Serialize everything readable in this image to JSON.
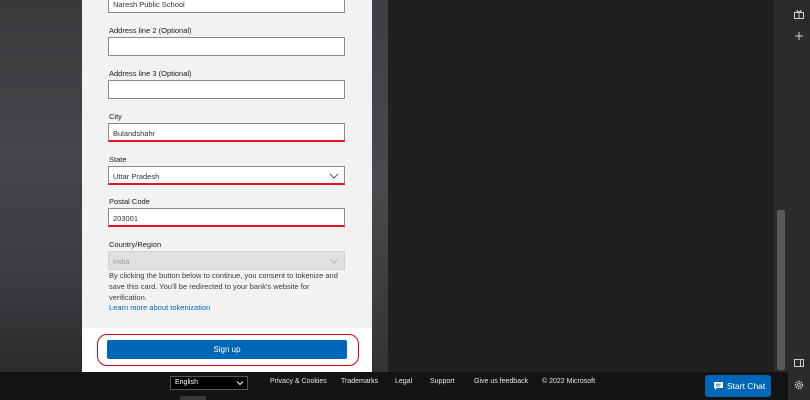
{
  "form": {
    "address_line1_value": "Naresh Public School",
    "address_line2_label": "Address line 2 (Optional)",
    "address_line2_value": "",
    "address_line3_label": "Address line 3 (Optional)",
    "address_line3_value": "",
    "city_label": "City",
    "city_value": "Bulandshahr",
    "state_label": "State",
    "state_value": "Uttar Pradesh",
    "postal_label": "Postal Code",
    "postal_value": "203001",
    "country_label": "Country/Region",
    "country_value": "India",
    "consent_text": "By clicking the button below to continue, you consent to tokenize and save this card. You'll be redirected to your bank's website for verification.",
    "learn_link": "Learn more about tokenization",
    "signup_label": "Sign up"
  },
  "footer": {
    "language": "English",
    "links": [
      "Privacy & Cookies",
      "Trademarks",
      "Legal",
      "Support",
      "Give us feedback"
    ],
    "copyright": "© 2022 Microsoft"
  },
  "chat": {
    "label": "Start Chat"
  },
  "colors": {
    "accent": "#0067b8",
    "error": "#e81123",
    "highlight": "#d0021b"
  }
}
